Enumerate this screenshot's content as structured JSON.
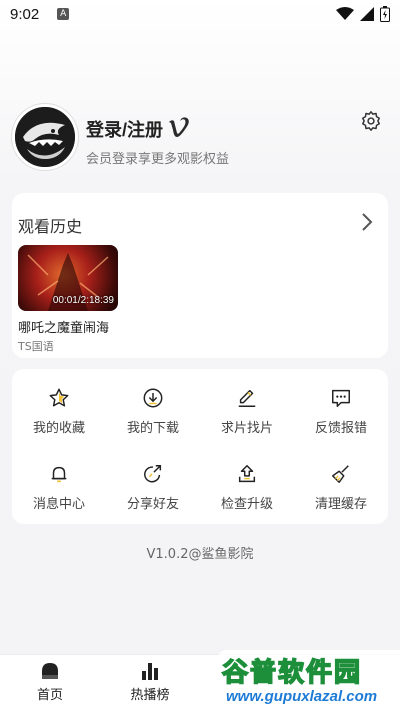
{
  "status_bar": {
    "time": "9:02",
    "notification_letter": "A"
  },
  "profile": {
    "username": "登录/注册",
    "subtitle": "会员登录享更多观影权益",
    "vip_icon": "vimeo-v-icon",
    "settings_icon": "gear-icon"
  },
  "history": {
    "title": "观看历史",
    "items": [
      {
        "title": "哪吒之魔童闹海",
        "tag": "TS国语",
        "progress": "00:01/2:18:39"
      }
    ]
  },
  "menu": [
    {
      "label": "我的收藏",
      "icon": "star-icon"
    },
    {
      "label": "我的下载",
      "icon": "download-icon"
    },
    {
      "label": "求片找片",
      "icon": "pencil-icon"
    },
    {
      "label": "反馈报错",
      "icon": "chat-icon"
    },
    {
      "label": "消息中心",
      "icon": "bell-icon"
    },
    {
      "label": "分享好友",
      "icon": "share-icon"
    },
    {
      "label": "检查升级",
      "icon": "upgrade-icon"
    },
    {
      "label": "清理缓存",
      "icon": "broom-icon"
    }
  ],
  "version": "V1.0.2@鲨鱼影院",
  "tabs": [
    {
      "label": "首页",
      "icon": "home-icon"
    },
    {
      "label": "热播榜",
      "icon": "bar-chart-icon"
    }
  ],
  "watermark": {
    "main": "谷普软件园",
    "url": "www.gupuxlazal.com"
  },
  "colors": {
    "accent": "#222222",
    "watermark_green": "#1d8f3a",
    "watermark_blue": "#1d7bd6"
  }
}
